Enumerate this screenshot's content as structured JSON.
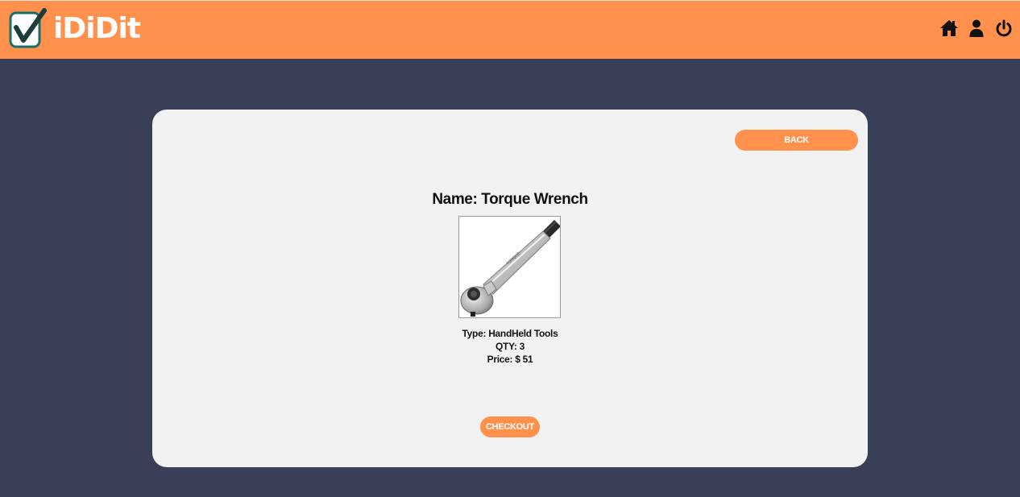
{
  "app": {
    "logo_text": "iDiDit",
    "brand_color": "#ff914d",
    "background_color": "#3a3f58",
    "card_color": "#f1f2f1"
  },
  "nav": {
    "icons": [
      "home-icon",
      "user-icon",
      "power-icon"
    ]
  },
  "product": {
    "name_label": "Name: Torque Wrench",
    "type_label": "Type: HandHeld Tools",
    "qty_label": "QTY: 3",
    "price_label": "Price: $ 51"
  },
  "buttons": {
    "back_label": "BACK",
    "checkout_label": "CHECKOUT"
  }
}
